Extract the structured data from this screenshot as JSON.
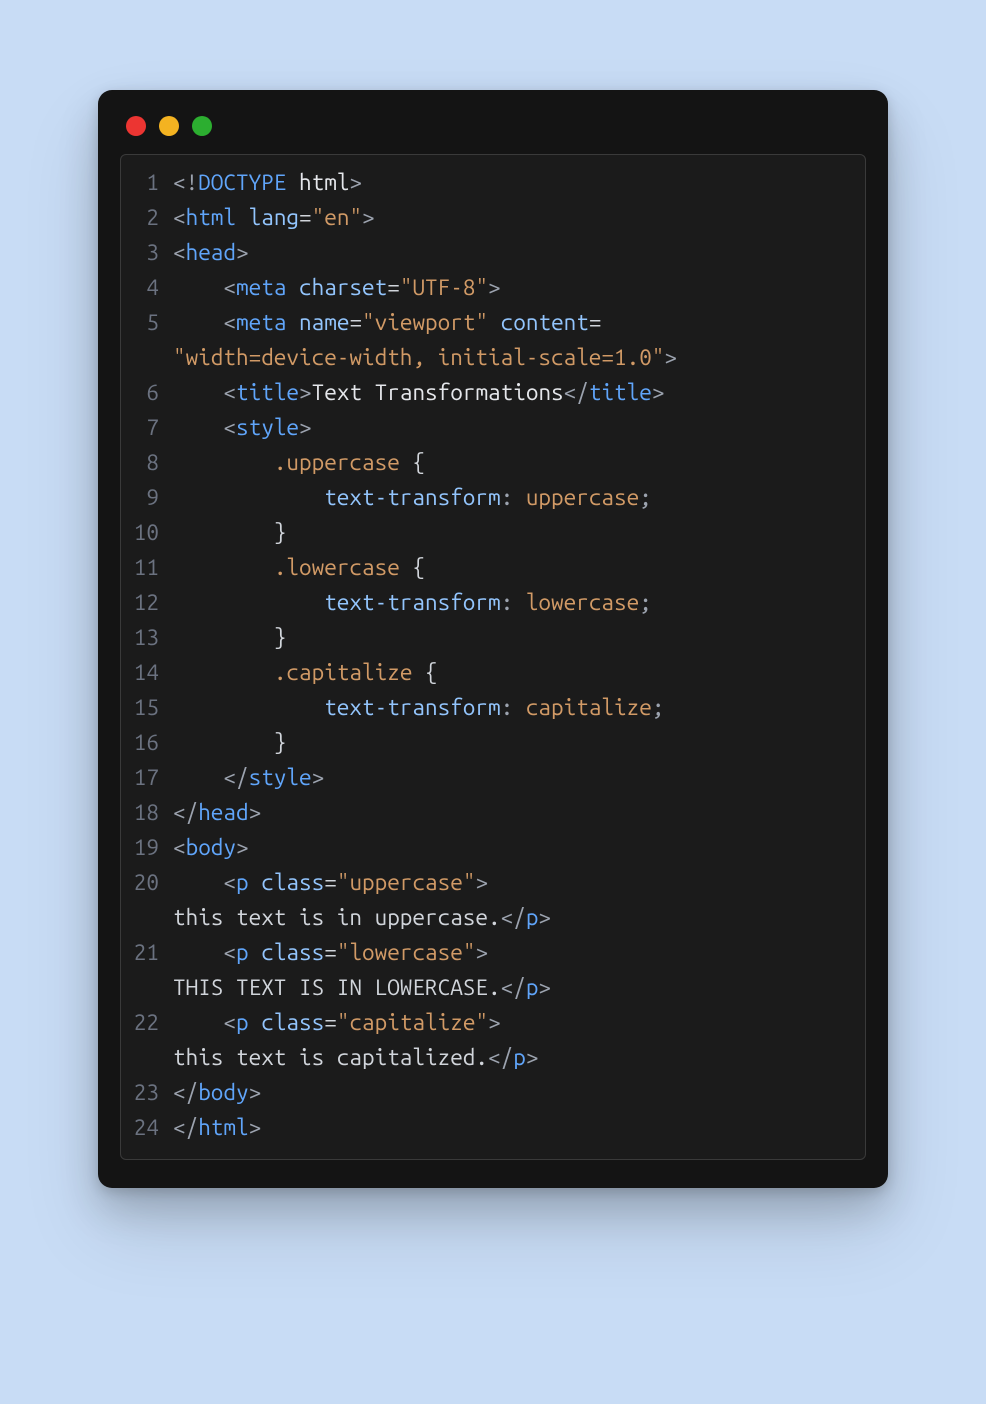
{
  "window": {
    "traffic_lights": [
      "red",
      "yellow",
      "green"
    ]
  },
  "code": {
    "lines": [
      {
        "num": "1",
        "tokens": [
          {
            "t": "<!",
            "c": "punct"
          },
          {
            "t": "DOCTYPE",
            "c": "doctype"
          },
          {
            "t": " ",
            "c": "text"
          },
          {
            "t": "html",
            "c": "white"
          },
          {
            "t": ">",
            "c": "punct"
          }
        ]
      },
      {
        "num": "2",
        "tokens": [
          {
            "t": "<",
            "c": "punct"
          },
          {
            "t": "html",
            "c": "tag"
          },
          {
            "t": " ",
            "c": "text"
          },
          {
            "t": "lang",
            "c": "attr"
          },
          {
            "t": "=",
            "c": "eq"
          },
          {
            "t": "\"en\"",
            "c": "str"
          },
          {
            "t": ">",
            "c": "punct"
          }
        ]
      },
      {
        "num": "3",
        "tokens": [
          {
            "t": "<",
            "c": "punct"
          },
          {
            "t": "head",
            "c": "tag"
          },
          {
            "t": ">",
            "c": "punct"
          }
        ]
      },
      {
        "num": "4",
        "tokens": [
          {
            "t": "    ",
            "c": "text"
          },
          {
            "t": "<",
            "c": "punct"
          },
          {
            "t": "meta",
            "c": "tag"
          },
          {
            "t": " ",
            "c": "text"
          },
          {
            "t": "charset",
            "c": "attr"
          },
          {
            "t": "=",
            "c": "eq"
          },
          {
            "t": "\"UTF-8\"",
            "c": "str"
          },
          {
            "t": ">",
            "c": "punct"
          }
        ]
      },
      {
        "num": "5",
        "tokens": [
          {
            "t": "    ",
            "c": "text"
          },
          {
            "t": "<",
            "c": "punct"
          },
          {
            "t": "meta",
            "c": "tag"
          },
          {
            "t": " ",
            "c": "text"
          },
          {
            "t": "name",
            "c": "attr"
          },
          {
            "t": "=",
            "c": "eq"
          },
          {
            "t": "\"viewport\"",
            "c": "str"
          },
          {
            "t": " ",
            "c": "text"
          },
          {
            "t": "content",
            "c": "attr"
          },
          {
            "t": "=",
            "c": "eq"
          }
        ],
        "wrap": [
          {
            "t": "\"width=device-width, initial-scale=1.0\"",
            "c": "str"
          },
          {
            "t": ">",
            "c": "punct"
          }
        ]
      },
      {
        "num": "6",
        "tokens": [
          {
            "t": "    ",
            "c": "text"
          },
          {
            "t": "<",
            "c": "punct"
          },
          {
            "t": "title",
            "c": "tag"
          },
          {
            "t": ">",
            "c": "punct"
          },
          {
            "t": "Text Transformations",
            "c": "white"
          },
          {
            "t": "</",
            "c": "punct"
          },
          {
            "t": "title",
            "c": "tag"
          },
          {
            "t": ">",
            "c": "punct"
          }
        ]
      },
      {
        "num": "7",
        "tokens": [
          {
            "t": "    ",
            "c": "text"
          },
          {
            "t": "<",
            "c": "punct"
          },
          {
            "t": "style",
            "c": "tag"
          },
          {
            "t": ">",
            "c": "punct"
          }
        ]
      },
      {
        "num": "8",
        "tokens": [
          {
            "t": "        ",
            "c": "text"
          },
          {
            "t": ".uppercase",
            "c": "sel"
          },
          {
            "t": " ",
            "c": "text"
          },
          {
            "t": "{",
            "c": "brace"
          }
        ]
      },
      {
        "num": "9",
        "tokens": [
          {
            "t": "            ",
            "c": "text"
          },
          {
            "t": "text-transform",
            "c": "prop"
          },
          {
            "t": ":",
            "c": "punct"
          },
          {
            "t": " ",
            "c": "text"
          },
          {
            "t": "uppercase",
            "c": "val"
          },
          {
            "t": ";",
            "c": "punct"
          }
        ]
      },
      {
        "num": "10",
        "tokens": [
          {
            "t": "        ",
            "c": "text"
          },
          {
            "t": "}",
            "c": "brace"
          }
        ]
      },
      {
        "num": "11",
        "tokens": [
          {
            "t": "        ",
            "c": "text"
          },
          {
            "t": ".lowercase",
            "c": "sel"
          },
          {
            "t": " ",
            "c": "text"
          },
          {
            "t": "{",
            "c": "brace"
          }
        ]
      },
      {
        "num": "12",
        "tokens": [
          {
            "t": "            ",
            "c": "text"
          },
          {
            "t": "text-transform",
            "c": "prop"
          },
          {
            "t": ":",
            "c": "punct"
          },
          {
            "t": " ",
            "c": "text"
          },
          {
            "t": "lowercase",
            "c": "val"
          },
          {
            "t": ";",
            "c": "punct"
          }
        ]
      },
      {
        "num": "13",
        "tokens": [
          {
            "t": "        ",
            "c": "text"
          },
          {
            "t": "}",
            "c": "brace"
          }
        ]
      },
      {
        "num": "14",
        "tokens": [
          {
            "t": "        ",
            "c": "text"
          },
          {
            "t": ".capitalize",
            "c": "sel"
          },
          {
            "t": " ",
            "c": "text"
          },
          {
            "t": "{",
            "c": "brace"
          }
        ]
      },
      {
        "num": "15",
        "tokens": [
          {
            "t": "            ",
            "c": "text"
          },
          {
            "t": "text-transform",
            "c": "prop"
          },
          {
            "t": ":",
            "c": "punct"
          },
          {
            "t": " ",
            "c": "text"
          },
          {
            "t": "capitalize",
            "c": "val"
          },
          {
            "t": ";",
            "c": "punct"
          }
        ]
      },
      {
        "num": "16",
        "tokens": [
          {
            "t": "        ",
            "c": "text"
          },
          {
            "t": "}",
            "c": "brace"
          }
        ]
      },
      {
        "num": "17",
        "tokens": [
          {
            "t": "    ",
            "c": "text"
          },
          {
            "t": "</",
            "c": "punct"
          },
          {
            "t": "style",
            "c": "tag"
          },
          {
            "t": ">",
            "c": "punct"
          }
        ]
      },
      {
        "num": "18",
        "tokens": [
          {
            "t": "</",
            "c": "punct"
          },
          {
            "t": "head",
            "c": "tag"
          },
          {
            "t": ">",
            "c": "punct"
          }
        ]
      },
      {
        "num": "19",
        "tokens": [
          {
            "t": "<",
            "c": "punct"
          },
          {
            "t": "body",
            "c": "tag"
          },
          {
            "t": ">",
            "c": "punct"
          }
        ]
      },
      {
        "num": "20",
        "tokens": [
          {
            "t": "    ",
            "c": "text"
          },
          {
            "t": "<",
            "c": "punct"
          },
          {
            "t": "p",
            "c": "tag"
          },
          {
            "t": " ",
            "c": "text"
          },
          {
            "t": "class",
            "c": "attr"
          },
          {
            "t": "=",
            "c": "eq"
          },
          {
            "t": "\"uppercase\"",
            "c": "str"
          },
          {
            "t": ">",
            "c": "punct"
          }
        ],
        "wrap": [
          {
            "t": "this text is in uppercase.",
            "c": "text"
          },
          {
            "t": "</",
            "c": "punct"
          },
          {
            "t": "p",
            "c": "tag"
          },
          {
            "t": ">",
            "c": "punct"
          }
        ]
      },
      {
        "num": "21",
        "tokens": [
          {
            "t": "    ",
            "c": "text"
          },
          {
            "t": "<",
            "c": "punct"
          },
          {
            "t": "p",
            "c": "tag"
          },
          {
            "t": " ",
            "c": "text"
          },
          {
            "t": "class",
            "c": "attr"
          },
          {
            "t": "=",
            "c": "eq"
          },
          {
            "t": "\"lowercase\"",
            "c": "str"
          },
          {
            "t": ">",
            "c": "punct"
          }
        ],
        "wrap": [
          {
            "t": "THIS TEXT IS IN LOWERCASE.",
            "c": "text"
          },
          {
            "t": "</",
            "c": "punct"
          },
          {
            "t": "p",
            "c": "tag"
          },
          {
            "t": ">",
            "c": "punct"
          }
        ]
      },
      {
        "num": "22",
        "tokens": [
          {
            "t": "    ",
            "c": "text"
          },
          {
            "t": "<",
            "c": "punct"
          },
          {
            "t": "p",
            "c": "tag"
          },
          {
            "t": " ",
            "c": "text"
          },
          {
            "t": "class",
            "c": "attr"
          },
          {
            "t": "=",
            "c": "eq"
          },
          {
            "t": "\"capitalize\"",
            "c": "str"
          },
          {
            "t": ">",
            "c": "punct"
          }
        ],
        "wrap": [
          {
            "t": "this text is capitalized.",
            "c": "text"
          },
          {
            "t": "</",
            "c": "punct"
          },
          {
            "t": "p",
            "c": "tag"
          },
          {
            "t": ">",
            "c": "punct"
          }
        ]
      },
      {
        "num": "23",
        "tokens": [
          {
            "t": "</",
            "c": "punct"
          },
          {
            "t": "body",
            "c": "tag"
          },
          {
            "t": ">",
            "c": "punct"
          }
        ]
      },
      {
        "num": "24",
        "tokens": [
          {
            "t": "</",
            "c": "punct"
          },
          {
            "t": "html",
            "c": "tag"
          },
          {
            "t": ">",
            "c": "punct"
          }
        ]
      }
    ]
  }
}
